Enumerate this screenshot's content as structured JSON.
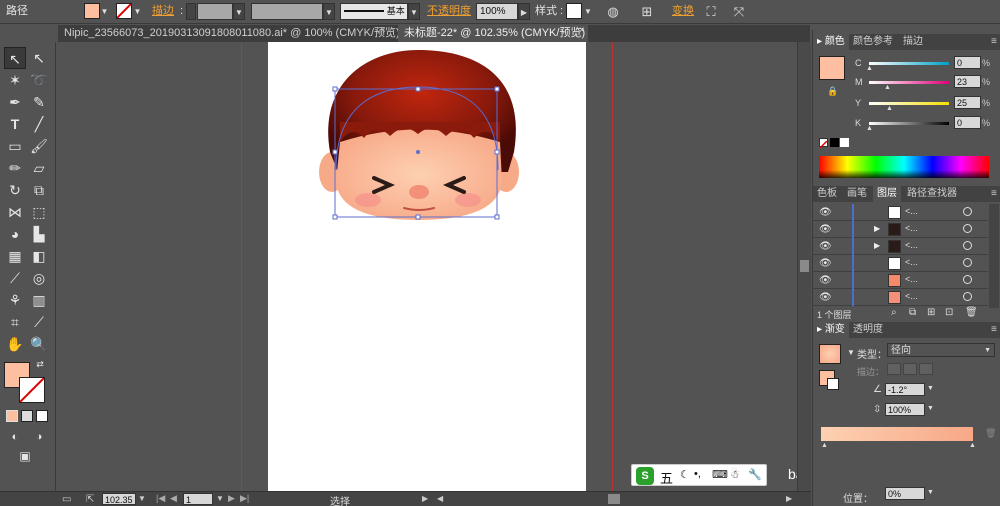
{
  "control_bar": {
    "path_label": "路径",
    "stroke_label": "描边",
    "stroke_style": "基本",
    "opacity_label": "不透明度",
    "opacity_value": "100%",
    "style_label": "样式",
    "transform_label": "变换"
  },
  "tabs": [
    {
      "label": "Nipic_23566073_20190313091808011080.ai* @ 100% (CMYK/预览)"
    },
    {
      "label": "未标题-22* @ 102.35% (CMYK/预览)"
    }
  ],
  "color_panel": {
    "tabs": [
      "颜色",
      "颜色参考",
      "描边"
    ],
    "channels": [
      {
        "name": "C",
        "value": "0"
      },
      {
        "name": "M",
        "value": "23"
      },
      {
        "name": "Y",
        "value": "25"
      },
      {
        "name": "K",
        "value": "0"
      }
    ],
    "pct_sign": "%",
    "fill_color": "#fdbf9f"
  },
  "layers_panel": {
    "tabs": [
      "色板",
      "画笔",
      "图层",
      "路径查找器"
    ],
    "layers": [
      {
        "name": "<..."
      },
      {
        "name": "<..."
      },
      {
        "name": "<..."
      },
      {
        "name": "<..."
      },
      {
        "name": "<..."
      },
      {
        "name": "<..."
      }
    ],
    "footer": "1 个图层"
  },
  "gradient_panel": {
    "tabs": [
      "渐变",
      "透明度"
    ],
    "type_label": "类型：",
    "type_value": "径向",
    "stroke_label": "描边：",
    "angle_value": "-1.2°",
    "scale_value": "100%",
    "position_label": "位置：",
    "position_value": "0%"
  },
  "status_bar": {
    "zoom": "102.35",
    "page": "1",
    "tool": "选择"
  },
  "ime_bar": {
    "label": "五"
  },
  "watermark": "baidu.com",
  "colors": {
    "accent_link": "#f0a030",
    "face_skin": "#fdbf9f",
    "hair": "#8a1a0c"
  }
}
